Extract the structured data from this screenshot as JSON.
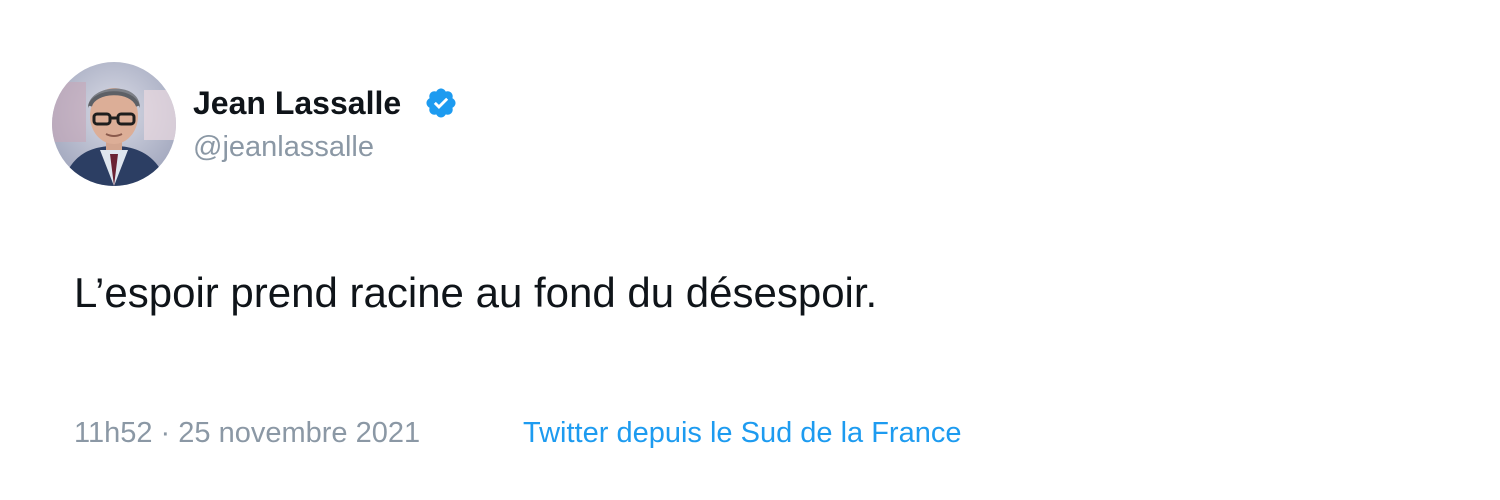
{
  "author": {
    "name": "Jean Lassalle",
    "handle": "@jeanlassalle",
    "verified": true,
    "avatar_icon": "profile-photo"
  },
  "tweet": {
    "text": "L’espoir prend racine au fond du désespoir."
  },
  "footer": {
    "timestamp": "11h52 · 25 novembre 2021",
    "source": "Twitter depuis le Sud de la France"
  },
  "colors": {
    "text_primary": "#0f1419",
    "text_secondary": "#8b98a5",
    "accent": "#1d9bf0",
    "background": "#ffffff"
  }
}
